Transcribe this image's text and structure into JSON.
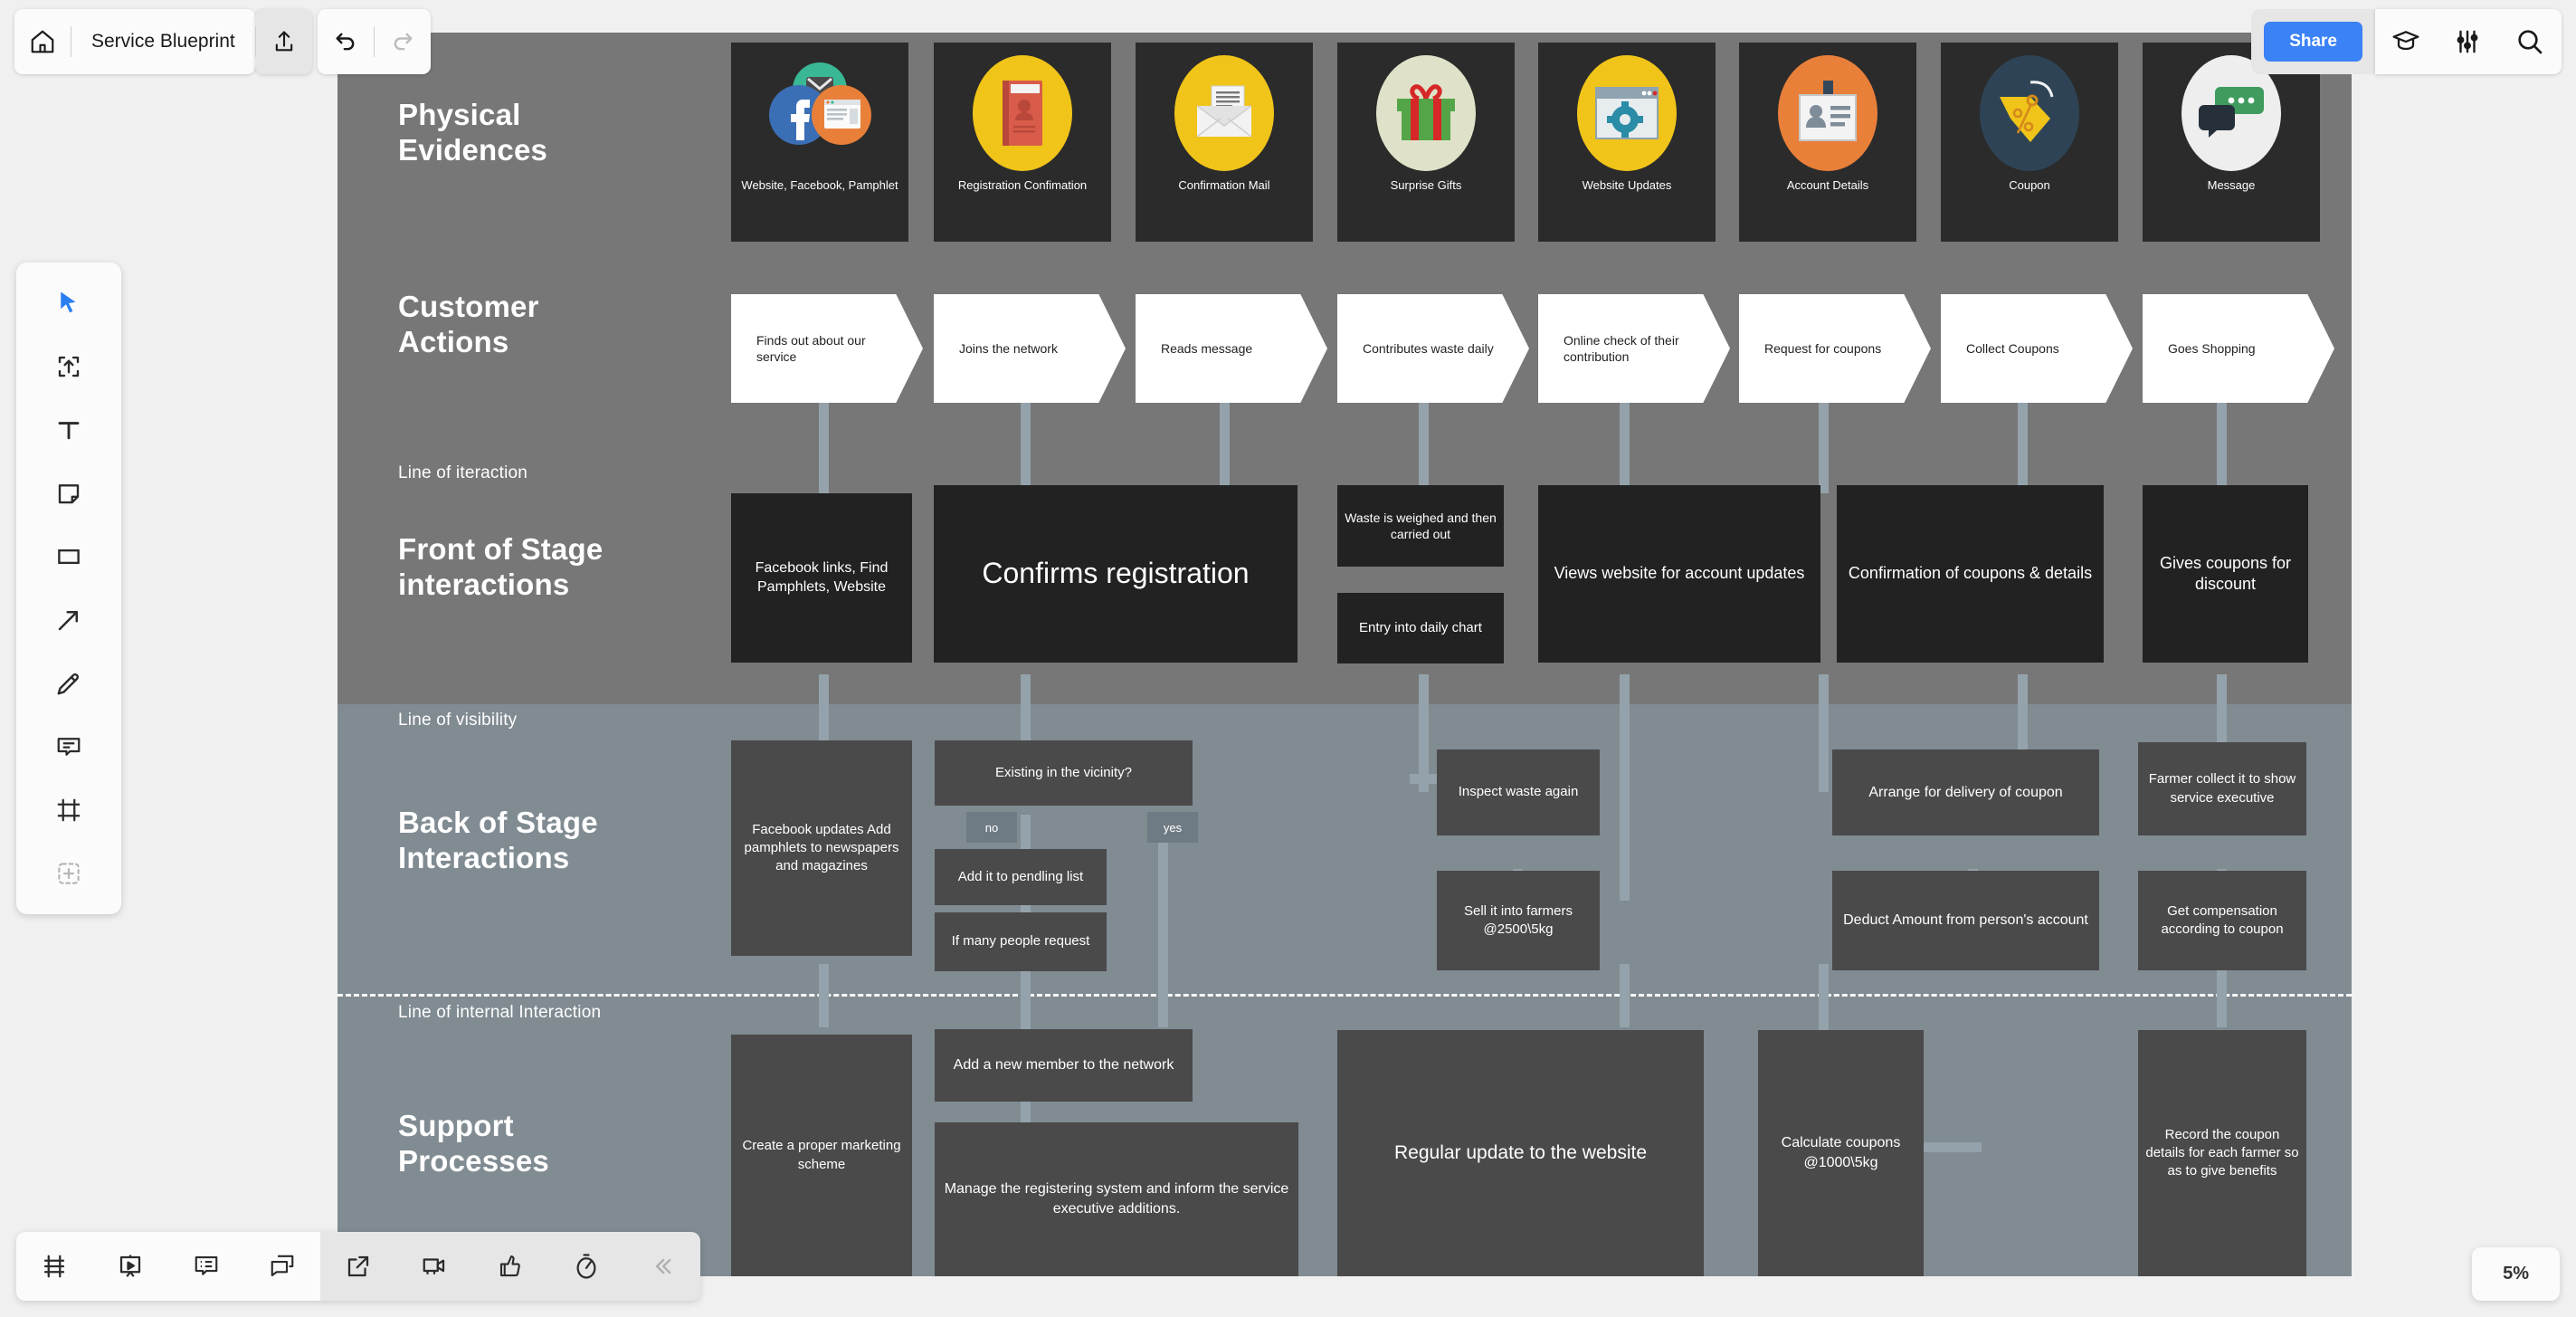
{
  "app": {
    "doc_title": "Service Blueprint",
    "zoom_level": "5%"
  },
  "toolbar": {
    "home_icon": "home-icon",
    "upload_icon": "upload-icon",
    "undo_icon": "undo-icon",
    "redo_icon": "redo-icon",
    "share_label": "Share",
    "tutorial_icon": "graduation-cap-icon",
    "settings_icon": "sliders-icon",
    "search_icon": "search-icon"
  },
  "tools": [
    {
      "name": "select-tool",
      "icon": "cursor-icon",
      "active": true
    },
    {
      "name": "upload-tool",
      "icon": "upload-box-icon",
      "active": false
    },
    {
      "name": "text-tool",
      "icon": "text-icon",
      "active": false
    },
    {
      "name": "sticky-note-tool",
      "icon": "sticky-note-icon",
      "active": false
    },
    {
      "name": "shape-tool",
      "icon": "rectangle-icon",
      "active": false
    },
    {
      "name": "connector-tool",
      "icon": "arrow-icon",
      "active": false
    },
    {
      "name": "pen-tool",
      "icon": "pen-icon",
      "active": false
    },
    {
      "name": "comment-tool",
      "icon": "comment-icon",
      "active": false
    },
    {
      "name": "frame-tool",
      "icon": "frame-icon",
      "active": false
    },
    {
      "name": "add-more-tool",
      "icon": "plus-box-icon",
      "active": false
    }
  ],
  "bottom_toolbar": [
    {
      "name": "frames-panel-button",
      "icon": "frames-icon"
    },
    {
      "name": "presentation-button",
      "icon": "presentation-icon"
    },
    {
      "name": "comments-panel-button",
      "icon": "comment-list-icon"
    },
    {
      "name": "chat-button",
      "icon": "chat-icon"
    },
    {
      "name": "share-link-button",
      "icon": "external-link-icon"
    },
    {
      "name": "video-call-button",
      "icon": "video-camera-icon"
    },
    {
      "name": "reactions-button",
      "icon": "thumbs-up-icon"
    },
    {
      "name": "timer-button",
      "icon": "timer-icon"
    },
    {
      "name": "collapse-button",
      "icon": "double-chevron-left-icon"
    }
  ],
  "blueprint": {
    "rows": {
      "physical_evidences": "Physical\nEvidences",
      "physical_evidences_l1": "Physical",
      "physical_evidences_l2": "Evidences",
      "customer_actions_l1": "Customer",
      "customer_actions_l2": "Actions",
      "front_stage_l1": "Front of Stage",
      "front_stage_l2": "interactions",
      "back_stage_l1": "Back of Stage",
      "back_stage_l2": "Interactions",
      "support_l1": "Support",
      "support_l2": "Processes"
    },
    "lines": {
      "interaction": "Line of iteraction",
      "visibility": "Line of visibility",
      "internal": "Line of internal Interaction"
    },
    "physical_evidences": [
      {
        "caption": "Website, Facebook, Pamphlet",
        "icon": "facebook-email-website-icon",
        "bg": "#2b2b2b"
      },
      {
        "caption": "Registration Confimation",
        "icon": "registration-book-icon",
        "bg": "#f0c419"
      },
      {
        "caption": "Confirmation Mail",
        "icon": "envelope-letter-icon",
        "bg": "#f0c419"
      },
      {
        "caption": "Surprise Gifts",
        "icon": "gift-box-icon",
        "bg": "#dfe2c8"
      },
      {
        "caption": "Website Updates",
        "icon": "browser-gear-icon",
        "bg": "#f0c419"
      },
      {
        "caption": "Account Details",
        "icon": "id-card-icon",
        "bg": "#e8803a"
      },
      {
        "caption": "Coupon",
        "icon": "price-tag-icon",
        "bg": "#2e4456"
      },
      {
        "caption": "Message",
        "icon": "speech-bubbles-icon",
        "bg": "#eeeeee"
      }
    ],
    "customer_actions": [
      "Finds out about our service",
      "Joins the network",
      "Reads message",
      "Contributes waste daily",
      "Online check of their contribution",
      "Request for coupons",
      "Collect Coupons",
      "Goes Shopping"
    ],
    "front_of_stage": [
      {
        "text": "Facebook links, Find Pamphlets, Website",
        "size": "small"
      },
      {
        "text": "Confirms registration",
        "size": "large"
      },
      {
        "text": "Waste is weighed and then carried out",
        "size": "small"
      },
      {
        "text": "Entry into daily chart",
        "size": "small"
      },
      {
        "text": "Views website for account updates",
        "size": "medium"
      },
      {
        "text": "Confirmation of coupons & details",
        "size": "medium"
      },
      {
        "text": "Gives coupons for discount",
        "size": "medium"
      }
    ],
    "back_of_stage": [
      {
        "text": "Facebook updates Add pamphlets to newspapers and magazines"
      },
      {
        "text": "Existing in the vicinity?"
      },
      {
        "text": "Add it to pendling list"
      },
      {
        "text": "If many people request"
      },
      {
        "text": "Inspect waste again"
      },
      {
        "text": "Sell it into farmers @2500\\5kg"
      },
      {
        "text": "Arrange for delivery of coupon"
      },
      {
        "text": "Deduct Amount from person's account"
      },
      {
        "text": "Farmer collect it to show service executive"
      },
      {
        "text": "Get compensation according to coupon"
      }
    ],
    "decision_labels": {
      "no": "no",
      "yes": "yes"
    },
    "support_processes": [
      {
        "text": "Create a proper marketing scheme"
      },
      {
        "text": "Add a new member to the network"
      },
      {
        "text": "Manage the registering system and inform the service executive additions."
      },
      {
        "text": "Regular update to the website"
      },
      {
        "text": "Calculate coupons @1000\\5kg"
      },
      {
        "text": "Record the coupon details for each farmer so as to give benefits"
      }
    ]
  }
}
